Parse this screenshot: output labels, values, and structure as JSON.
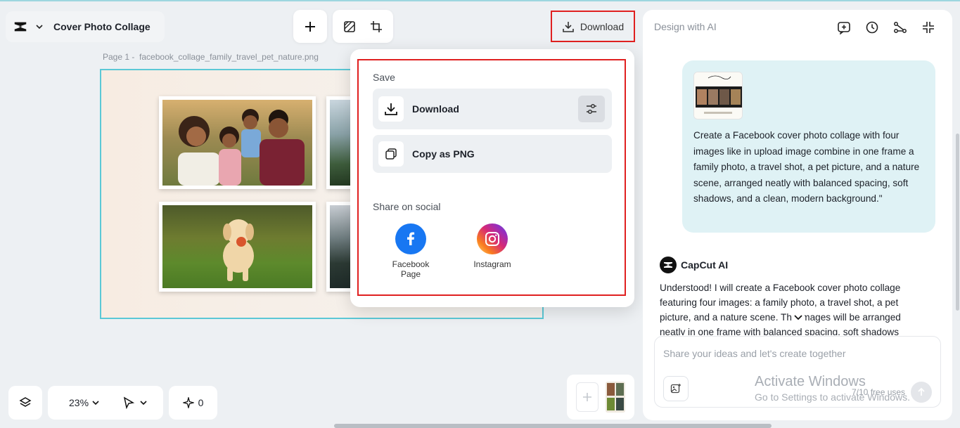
{
  "header": {
    "project_title": "Cover Photo Collage",
    "download_label": "Download"
  },
  "canvas": {
    "page_label": "Page 1 -",
    "file_name": "facebook_collage_family_travel_pet_nature.png"
  },
  "download_menu": {
    "save_section_label": "Save",
    "download_option_label": "Download",
    "copy_png_label": "Copy as PNG",
    "share_section_label": "Share on social",
    "facebook_label": "Facebook Page",
    "instagram_label": "Instagram"
  },
  "ai_panel": {
    "title": "Design with AI",
    "user_message": "Create a Facebook cover photo collage with four images like in upload image combine in one frame a family photo, a travel shot, a pet picture, and a nature scene, arranged neatly with balanced spacing, soft shadows, and a clean, modern background.\"",
    "assistant_name": "CapCut AI",
    "assistant_message": "Understood! I will create a Facebook cover photo collage featuring four images: a family photo, a travel shot, a pet picture, and a nature scene. The images will be arranged neatly in one frame with balanced spacing, soft shadows",
    "input_placeholder": "Share your ideas and let's create together",
    "free_uses": "7/10 free uses"
  },
  "bottom_bar": {
    "zoom": "23%",
    "magic_count": "0"
  },
  "system": {
    "activate_line1": "Activate Windows",
    "activate_line2": "Go to Settings to activate Windows."
  },
  "colors": {
    "accent_red": "#e02020",
    "canvas_border": "#5bc8d6",
    "user_bubble": "#dff2f5",
    "facebook_blue": "#1877f2"
  },
  "icons": [
    "capcut-logo-icon",
    "chevron-down-icon",
    "plus-icon",
    "background-remove-icon",
    "resize-icon",
    "download-icon",
    "sliders-icon",
    "copy-icon",
    "facebook-icon",
    "instagram-icon",
    "new-chat-icon",
    "history-icon",
    "share-icon",
    "collapse-icon",
    "image-upload-icon",
    "send-icon",
    "layers-icon",
    "pointer-icon",
    "sparkle-icon"
  ]
}
